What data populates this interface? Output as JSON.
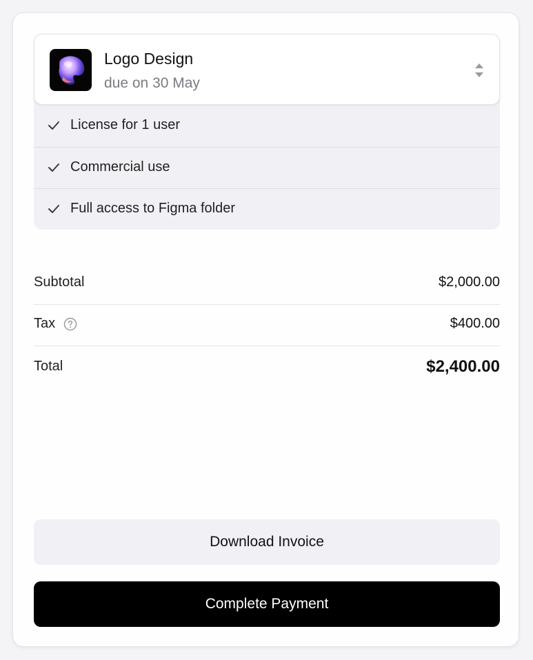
{
  "product": {
    "name": "Logo Design",
    "due": "due on 30 May",
    "thumbnail_icon": "abstract-3d-shape-image",
    "selector_icon": "chevron-up-down-icon"
  },
  "features": [
    {
      "label": "License for 1 user",
      "icon": "check-icon"
    },
    {
      "label": "Commercial use",
      "icon": "check-icon"
    },
    {
      "label": "Full access to Figma folder",
      "icon": "check-icon"
    }
  ],
  "summary": {
    "subtotal_label": "Subtotal",
    "subtotal_value": "$2,000.00",
    "tax_label": "Tax",
    "tax_value": "$400.00",
    "tax_icon": "help-circle-icon",
    "total_label": "Total",
    "total_value": "$2,400.00"
  },
  "actions": {
    "download_label": "Download Invoice",
    "pay_label": "Complete Payment"
  },
  "colors": {
    "primary_button": "#000000",
    "secondary_button": "#f1f0f4",
    "feature_panel": "#f1f0f4",
    "muted_text": "#7b7b82"
  }
}
